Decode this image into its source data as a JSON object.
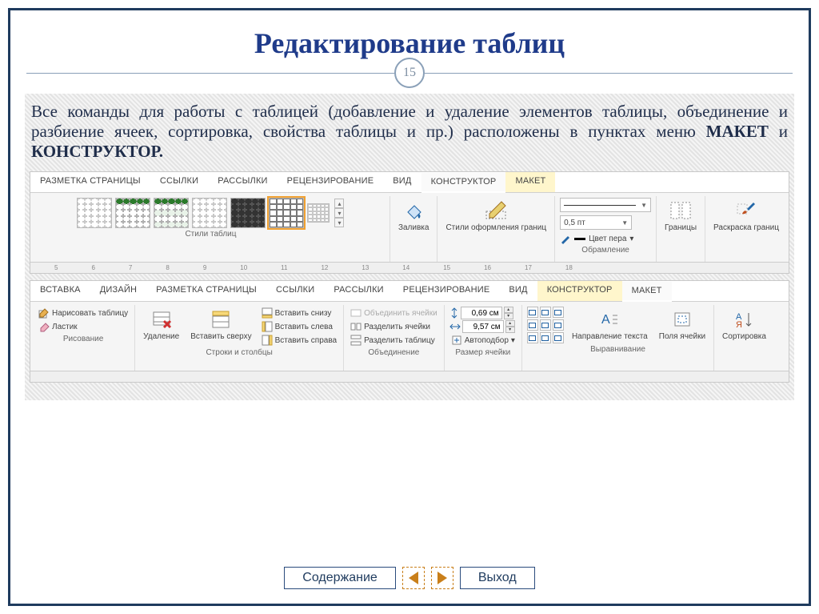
{
  "slide": {
    "title": "Редактирование таблиц",
    "page_number": "15",
    "description_pre": "Все команды для работы с таблицей (добавление и удаление элементов таблицы, объединение и разбиение ячеек,  сортировка,  свойства таблицы и пр.) расположены в пунктах меню ",
    "description_bold1": "МАКЕТ",
    "description_mid": " и ",
    "description_bold2": "КОНСТРУКТОР."
  },
  "ribbon1": {
    "tabs": [
      "РАЗМЕТКА СТРАНИЦЫ",
      "ССЫЛКИ",
      "РАССЫЛКИ",
      "РЕЦЕНЗИРОВАНИЕ",
      "ВИД",
      "КОНСТРУКТОР",
      "МАКЕТ"
    ],
    "active_tab": "КОНСТРУКТОР",
    "groups": {
      "styles": "Стили таблиц",
      "fill": "Заливка",
      "border_styles": "Стили оформления границ",
      "pen_width": "0,5 пт",
      "pen_color": "Цвет пера",
      "borders": "Границы",
      "painter": "Раскраска границ",
      "framing": "Обрамление"
    },
    "ruler_marks": [
      "5",
      "6",
      "7",
      "8",
      "9",
      "10",
      "11",
      "12",
      "13",
      "14",
      "15",
      "16",
      "17",
      "18"
    ]
  },
  "ribbon2": {
    "tabs": [
      "ВСТАВКА",
      "ДИЗАЙН",
      "РАЗМЕТКА СТРАНИЦЫ",
      "ССЫЛКИ",
      "РАССЫЛКИ",
      "РЕЦЕНЗИРОВАНИЕ",
      "ВИД",
      "КОНСТРУКТОР",
      "МАКЕТ"
    ],
    "active_tab": "МАКЕТ",
    "drawing": {
      "group": "Рисование",
      "draw": "Нарисовать таблицу",
      "eraser": "Ластик"
    },
    "rows_cols": {
      "group": "Строки и столбцы",
      "delete": "Удаление",
      "insert_top": "Вставить сверху",
      "insert_bottom": "Вставить снизу",
      "insert_left": "Вставить слева",
      "insert_right": "Вставить справа"
    },
    "merge": {
      "group": "Объединение",
      "merge_cells": "Объединить ячейки",
      "split_cells": "Разделить ячейки",
      "split_table": "Разделить таблицу"
    },
    "cell_size": {
      "group": "Размер ячейки",
      "height": "0,69 см",
      "width": "9,57 см",
      "autofit": "Автоподбор"
    },
    "alignment": {
      "group": "Выравнивание",
      "text_direction": "Направление текста",
      "cell_margins": "Поля ячейки"
    },
    "sort": "Сортировка"
  },
  "nav": {
    "contents": "Содержание",
    "exit": "Выход"
  }
}
